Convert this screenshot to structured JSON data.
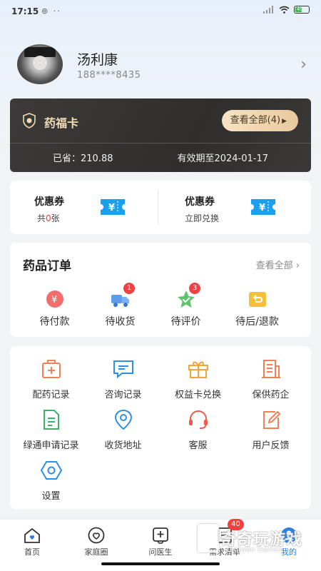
{
  "status_bar": {
    "time": "17:15",
    "icons": "⊚ ··",
    "battery": "49"
  },
  "profile": {
    "name": "汤利康",
    "phone": "188****8435"
  },
  "yfk_card": {
    "title": "药福卡",
    "view_all": "查看全部(4)",
    "saved": "已省：210.88",
    "expiry": "有效期至2024-01-17"
  },
  "coupons": [
    {
      "title": "优惠券",
      "sub_prefix": "共",
      "sub_count": "0",
      "sub_suffix": "张"
    },
    {
      "title": "优惠券",
      "sub": "立即兑换"
    }
  ],
  "orders": {
    "title": "药品订单",
    "view_all": "查看全部",
    "items": [
      {
        "label": "待付款",
        "icon": "yen-icon",
        "badge": ""
      },
      {
        "label": "待收货",
        "icon": "truck-icon",
        "badge": "1"
      },
      {
        "label": "待评价",
        "icon": "star-icon",
        "badge": "3"
      },
      {
        "label": "待后/退款",
        "icon": "return-icon",
        "badge": ""
      }
    ]
  },
  "services": [
    {
      "label": "配药记录",
      "icon": "medicine-box-icon"
    },
    {
      "label": "咨询记录",
      "icon": "chat-icon"
    },
    {
      "label": "权益卡兑换",
      "icon": "gift-icon"
    },
    {
      "label": "保供药企",
      "icon": "building-icon"
    },
    {
      "label": "绿通申请记录",
      "icon": "document-icon"
    },
    {
      "label": "收货地址",
      "icon": "location-icon"
    },
    {
      "label": "客服",
      "icon": "headset-icon"
    },
    {
      "label": "用户反馈",
      "icon": "edit-icon"
    },
    {
      "label": "设置",
      "icon": "settings-icon"
    }
  ],
  "tabbar": [
    {
      "label": "首页",
      "icon": "home-icon"
    },
    {
      "label": "家庭圈",
      "icon": "heart-icon"
    },
    {
      "label": "问医生",
      "icon": "doctor-icon"
    },
    {
      "label": "需求清单",
      "icon": "list-icon",
      "badge": "40"
    },
    {
      "label": "我的",
      "icon": "user-icon",
      "active": true
    }
  ],
  "watermark": {
    "main": "奇奇玩游戏",
    "sub": "Qiqiwan Games"
  },
  "colors": {
    "accent": "#2d7fe0",
    "card_dark": "#33312f",
    "gold_text": "#f3dcb6",
    "badge_red": "#f04040",
    "coupon_blue": "#1aa0ee"
  }
}
